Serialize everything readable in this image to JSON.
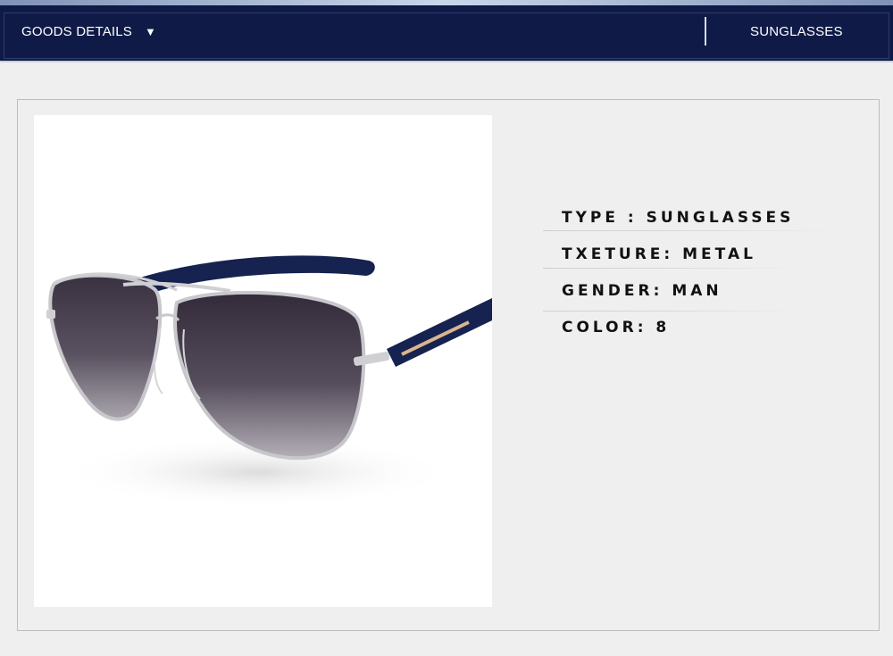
{
  "header": {
    "title": "GOODS DETAILS",
    "caret": "▼",
    "right_label": "SUNGLASSES"
  },
  "product": {
    "image_icon": "aviator-sunglasses-image",
    "specs": [
      "TYPE : SUNGLASSES",
      "TXETURE: METAL",
      "GENDER: MAN",
      "COLOR: 8"
    ]
  },
  "colors": {
    "header_bg": "#0f1b46",
    "page_bg": "#efefef",
    "text_dark": "#111111"
  }
}
